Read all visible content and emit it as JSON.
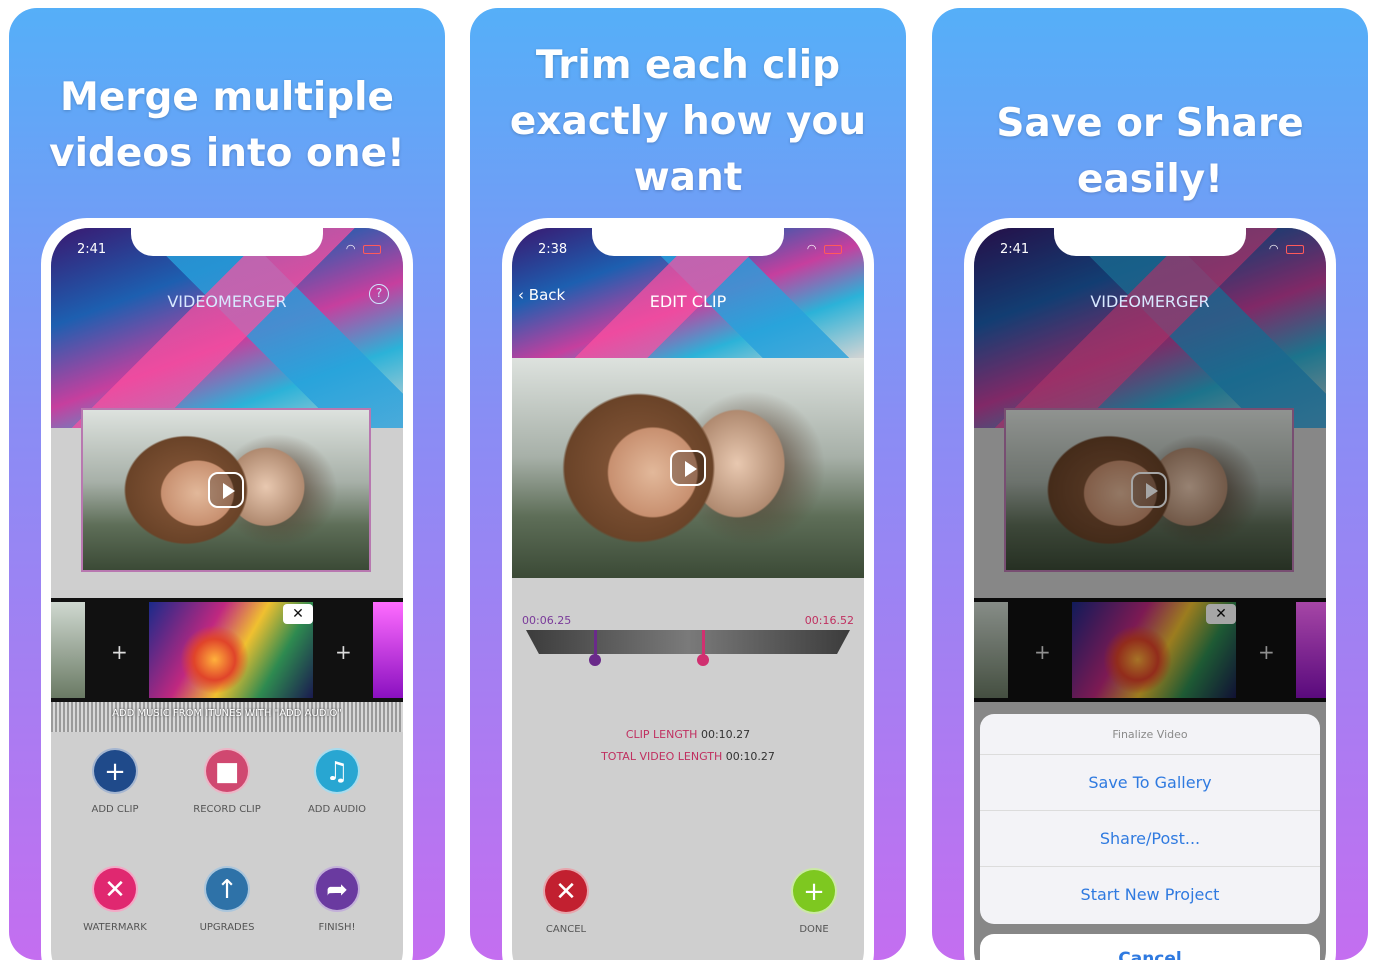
{
  "panels": [
    {
      "headline_lines": [
        "Merge multiple",
        "videos into one!"
      ],
      "status_time": "2:41",
      "app_title": "VIDEOMERGER",
      "help_glyph": "?",
      "audio_hint": "ADD MUSIC FROM ITUNES WITH \"ADD AUDIO\"",
      "buttons": [
        {
          "label": "ADD CLIP",
          "icon": "plus-icon",
          "glyph": "+",
          "color": "#1f4a8a"
        },
        {
          "label": "RECORD CLIP",
          "icon": "camera-icon",
          "glyph": "■",
          "color": "#d04870"
        },
        {
          "label": "ADD AUDIO",
          "icon": "music-note-icon",
          "glyph": "♫",
          "color": "#28a6d2"
        },
        {
          "label": "WATERMARK",
          "icon": "close-icon",
          "glyph": "✕",
          "color": "#e02870"
        },
        {
          "label": "UPGRADES",
          "icon": "arrow-up-icon",
          "glyph": "↑",
          "color": "#2e72a8"
        },
        {
          "label": "FINISH!",
          "icon": "share-icon",
          "glyph": "➦",
          "color": "#6a3aa0"
        }
      ]
    },
    {
      "headline_lines": [
        "Trim each clip",
        "exactly how you",
        "want"
      ],
      "status_time": "2:38",
      "back_label": "Back",
      "screen_title": "EDIT CLIP",
      "trim_start": "00:06.25",
      "trim_end": "00:16.52",
      "clip_length_label": "CLIP LENGTH",
      "clip_length_value": "00:10.27",
      "total_length_label": "TOTAL VIDEO LENGTH",
      "total_length_value": "00:10.27",
      "cancel_label": "CANCEL",
      "done_label": "DONE"
    },
    {
      "headline_lines": [
        "Save or Share easily!"
      ],
      "status_time": "2:41",
      "app_title": "VIDEOMERGER",
      "sheet_title": "Finalize Video",
      "sheet_options": [
        "Save To Gallery",
        "Share/Post...",
        "Start New Project"
      ],
      "cancel_label": "Cancel"
    }
  ],
  "colors": {
    "gradient_top": "#55aff8",
    "gradient_bottom": "#c46ef0",
    "ios_blue": "#2f7ae0",
    "trim_magenta": "#c03060"
  }
}
